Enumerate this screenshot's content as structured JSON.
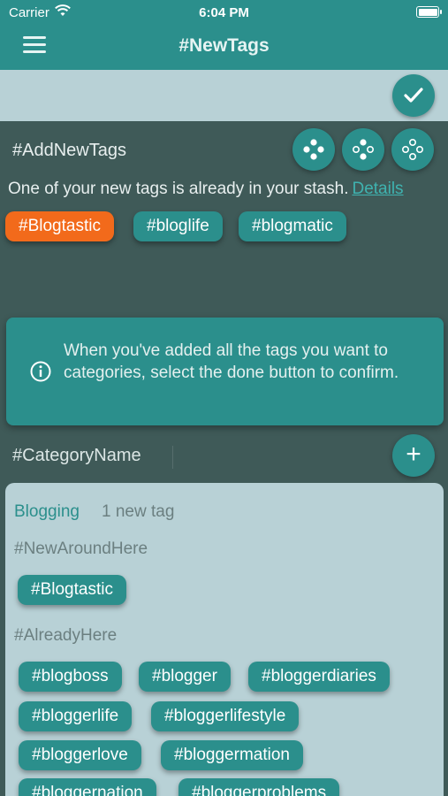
{
  "status_bar": {
    "carrier": "Carrier",
    "time": "6:04 PM"
  },
  "nav": {
    "title": "#NewTags"
  },
  "add_tags": {
    "title": "#AddNewTags",
    "message": "One of your new tags is already in your stash.",
    "details_link": "Details",
    "chips": [
      "#Blogtastic",
      "#bloglife",
      "#blogmatic"
    ]
  },
  "info": {
    "text": "When you've added all the tags you want to categories, select the done button to confirm."
  },
  "category": {
    "placeholder": "#CategoryName",
    "add_symbol": "+"
  },
  "card": {
    "category_name": "Blogging",
    "count_text": "1 new tag",
    "new_heading": "#NewAroundHere",
    "new_tags": [
      "#Blogtastic"
    ],
    "existing_heading": "#AlreadyHere",
    "existing_tags": [
      "#blogboss",
      "#blogger",
      "#bloggerdiaries",
      "#bloggerlife",
      "#bloggerlifestyle",
      "#bloggerlove",
      "#bloggermation",
      "#bloggernation",
      "#bloggerproblems"
    ]
  },
  "colors": {
    "accent": "#2b8f8c",
    "highlight": "#f26a1b",
    "background": "#3f5a58",
    "panel": "#b8d1d6"
  },
  "icons": [
    "wifi-icon",
    "battery-icon",
    "menu-icon",
    "checkmark-icon",
    "dots-filled-icon",
    "dots-mixed-icon",
    "dots-outline-icon",
    "info-icon",
    "plus-icon"
  ]
}
